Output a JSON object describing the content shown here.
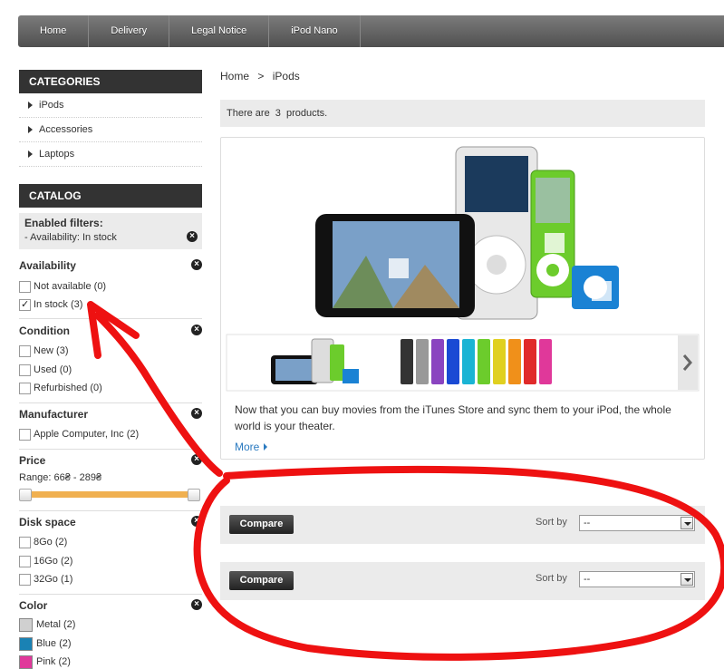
{
  "nav": [
    "Home",
    "Delivery",
    "Legal Notice",
    "iPod Nano"
  ],
  "categories": {
    "title": "CATEGORIES",
    "items": [
      "iPods",
      "Accessories",
      "Laptops"
    ]
  },
  "catalog": {
    "title": "CATALOG",
    "enabled_title": "Enabled filters:",
    "enabled_value": "- Availability: In stock",
    "availability": {
      "title": "Availability",
      "opts": [
        "Not available (0)",
        "In stock (3)"
      ]
    },
    "condition": {
      "title": "Condition",
      "opts": [
        "New (3)",
        "Used (0)",
        "Refurbished (0)"
      ]
    },
    "manufacturer": {
      "title": "Manufacturer",
      "opts": [
        "Apple Computer, Inc (2)"
      ]
    },
    "price": {
      "title": "Price",
      "range": "Range: 66₴ - 289₴"
    },
    "disk": {
      "title": "Disk space",
      "opts": [
        "8Go (2)",
        "16Go (2)",
        "32Go (1)"
      ]
    },
    "color": {
      "title": "Color",
      "opts": [
        "Metal (2)",
        "Blue (2)",
        "Pink (2)"
      ]
    }
  },
  "colors": {
    "metal": "#d0d0d0",
    "blue": "#1a82b4",
    "pink": "#e0389a",
    "annotation": "#ee1111"
  },
  "breadcrumb": {
    "home": "Home",
    "sep": ">",
    "current": "iPods"
  },
  "count": {
    "pre": "There are",
    "num": "3",
    "post": "products."
  },
  "feature": {
    "description": "Now that you can buy movies from the iTunes Store and sync them to your iPod, the whole world is your theater.",
    "more": "More"
  },
  "sortbar": {
    "compare": "Compare",
    "sort_label": "Sort by",
    "sort_value": "--"
  }
}
